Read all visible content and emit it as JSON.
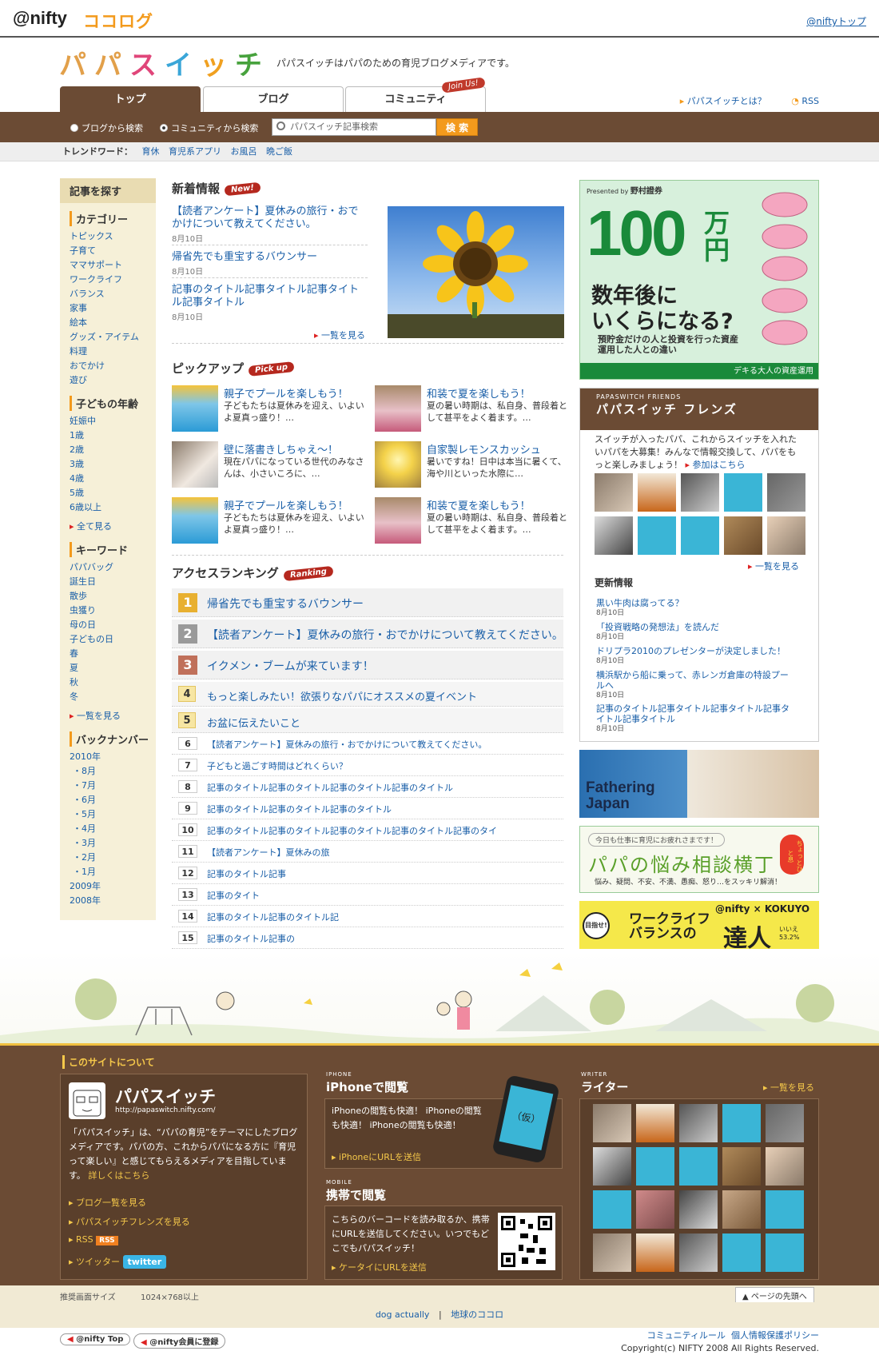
{
  "global": {
    "nifty": "@nifty",
    "cocolog": "ココログ",
    "top_link": "@niftyトップ"
  },
  "header": {
    "logo": [
      "パ",
      "パ",
      "ス",
      "イ",
      "ッ",
      "チ"
    ],
    "tagline": "パパスイッチはパパのための育児ブログメディアです。",
    "tabs": [
      "トップ",
      "ブログ",
      "コミュニティ"
    ],
    "join_badge": "Join Us!",
    "links": [
      "パパスイッチとは？",
      "RSS"
    ]
  },
  "search": {
    "radio_blog": "ブログから検索",
    "radio_community": "コミュニティから検索",
    "placeholder": "パパスイッチ記事検索",
    "button": "検 索"
  },
  "trend": {
    "label": "トレンドワード：",
    "words": [
      "育休",
      "育児系アプリ",
      "お風呂",
      "晩ご飯"
    ]
  },
  "leftnav": {
    "head": "記事を探す",
    "category": {
      "title": "カテゴリー",
      "items": [
        "トピックス",
        "子育て",
        "ママサポート",
        "ワークライフ",
        "バランス",
        "家事",
        "絵本",
        "グッズ・アイテム",
        "料理",
        "おでかけ",
        "遊び"
      ]
    },
    "age": {
      "title": "子どもの年齢",
      "items": [
        "妊娠中",
        "1歳",
        "2歳",
        "3歳",
        "4歳",
        "5歳",
        "6歳以上"
      ],
      "more": "全て見る"
    },
    "keyword": {
      "title": "キーワード",
      "items": [
        "パパバッグ",
        "誕生日",
        "散歩",
        "虫獲り",
        "母の日",
        "子どもの日",
        "春",
        "夏",
        "秋",
        "冬"
      ],
      "more": "一覧を見る"
    },
    "backnumber": {
      "title": "バックナンバー",
      "y2010": "2010年",
      "months": [
        "・8月",
        "・7月",
        "・6月",
        "・5月",
        "・4月",
        "・3月",
        "・2月",
        "・1月"
      ],
      "y2009": "2009年",
      "y2008": "2008年"
    }
  },
  "news": {
    "title": "新着情報",
    "badge": "New!",
    "items": [
      {
        "title": "【読者アンケート】夏休みの旅行・おでかけについて教えてください。",
        "date": "8月10日"
      },
      {
        "title": "帰省先でも重宝するバウンサー",
        "date": "8月10日"
      },
      {
        "title": "記事のタイトル記事タイトル記事タイトル記事タイトル",
        "date": "8月10日"
      }
    ],
    "more": "一覧を見る"
  },
  "pickup": {
    "title": "ピックアップ",
    "badge": "Pick up",
    "items": [
      {
        "title": "親子でプールを楽しもう！",
        "summary": "子どもたちは夏休みを迎え、いよいよ夏真っ盛り！…"
      },
      {
        "title": "和装で夏を楽しもう！",
        "summary": "夏の暑い時期は、私自身、普段着として甚平をよく着ます。…"
      },
      {
        "title": "壁に落書きしちゃえ〜！",
        "summary": "現在パパになっている世代のみなさんは、小さいころに、…"
      },
      {
        "title": "自家製レモンスカッシュ",
        "summary": "暑いですね！日中は本当に暑くて、海や川といった水際に…"
      },
      {
        "title": "親子でプールを楽しもう！",
        "summary": "子どもたちは夏休みを迎え、いよいよ夏真っ盛り！…"
      },
      {
        "title": "和装で夏を楽しもう！",
        "summary": "夏の暑い時期は、私自身、普段着として甚平をよく着ます。…"
      }
    ]
  },
  "ranking": {
    "title": "アクセスランキング",
    "badge": "Ranking",
    "items": [
      {
        "n": "1",
        "title": "帰省先でも重宝するバウンサー"
      },
      {
        "n": "2",
        "title": "【読者アンケート】夏休みの旅行・おでかけについて教えてください。"
      },
      {
        "n": "3",
        "title": "イクメン・ブームが来ています！"
      },
      {
        "n": "4",
        "title": "もっと楽しみたい！欲張りなパパにオススメの夏イベント"
      },
      {
        "n": "5",
        "title": "お盆に伝えたいこと"
      },
      {
        "n": "6",
        "title": "【読者アンケート】夏休みの旅行・おでかけについて教えてください。"
      },
      {
        "n": "7",
        "title": "子どもと過ごす時間はどれくらい？"
      },
      {
        "n": "8",
        "title": "記事のタイトル記事のタイトル記事のタイトル記事のタイトル"
      },
      {
        "n": "9",
        "title": "記事のタイトル記事のタイトル記事のタイトル"
      },
      {
        "n": "10",
        "title": "記事のタイトル記事のタイトル記事のタイトル記事のタイトル記事のタイ"
      },
      {
        "n": "11",
        "title": "【読者アンケート】夏休みの旅"
      },
      {
        "n": "12",
        "title": "記事のタイトル記事"
      },
      {
        "n": "13",
        "title": "記事のタイト"
      },
      {
        "n": "14",
        "title": "記事のタイトル記事のタイトル記"
      },
      {
        "n": "15",
        "title": "記事のタイトル記事の"
      }
    ]
  },
  "ad100": {
    "presented": "Presented by",
    "sponsor": "野村證券",
    "big": "100",
    "unit": "万円",
    "line1": "数年後に",
    "line2": "いくらになる?",
    "sub": "預貯金だけの人と投資を行った資産運用した人との違い",
    "foot": "デキる大人の資産運用"
  },
  "friends": {
    "eyebrow": "PAPASWITCH FRIENDS",
    "title": "パパスイッチ フレンズ",
    "desc": "スイッチが入ったパパ、これからスイッチを入れたいパパを大募集！みんなで情報交換して、パパをもっと楽しみましょう！",
    "join": "参加はこちら",
    "more": "一覧を見る",
    "update_title": "更新情報",
    "updates": [
      {
        "title": "黒い牛肉は腐ってる？",
        "date": "8月10日"
      },
      {
        "title": "「投資戦略の発想法」を読んだ",
        "date": "8月10日"
      },
      {
        "title": "ドリプラ2010のプレゼンターが決定しました！",
        "date": "8月10日"
      },
      {
        "title": "横浜駅から船に乗って、赤レンガ倉庫の特設プールへ",
        "date": "8月10日"
      },
      {
        "title": "記事のタイトル記事タイトル記事タイトル記事タイトル記事タイトル",
        "date": "8月10日"
      }
    ]
  },
  "banners": {
    "fathering": [
      "Fathering",
      "Japan"
    ],
    "nayami_top": "今日も仕事に育児にお疲れさまです！",
    "nayami": "パパの悩み相談横丁",
    "nayami_sub": "悩み、疑問、不安、不満、愚痴、怒り…をスッキリ解消！",
    "lantern": "ちょっとひと息",
    "wlb_prefix": "目指せ!",
    "wlb": [
      "ワークライフ",
      "バランスの"
    ],
    "wlb_big": "達人",
    "wlb_brand": "@nifty × KOKUYO",
    "wlb_stat": "いいえ 53.2%"
  },
  "footer": {
    "about_title": "このサイトについて",
    "site_name": "パパスイッチ",
    "site_url": "http://papaswitch.nifty.com/",
    "about_text": "「パパスイッチ」は、“パパの育児”をテーマにしたブログメディアです。パパの方、これからパパになる方に『育児って楽しい』と感じてもらえるメディアを目指しています。",
    "detail": "詳しくはこちら",
    "links": [
      "ブログ一覧を見る",
      "パパスイッチフレンズを見る",
      "RSS",
      "ツイッター"
    ],
    "rss_badge": "RSS",
    "twitter_badge": "twitter",
    "iphone_eyebrow": "IPHONE",
    "iphone_title": "iPhoneで閲覧",
    "iphone_text": "iPhoneの閲覧も快適！ iPhoneの閲覧も快適！ iPhoneの閲覧も快適！",
    "iphone_link": "iPhoneにURLを送信",
    "iphone_kari": "（仮）",
    "mobile_eyebrow": "MOBILE",
    "mobile_title": "携帯で閲覧",
    "mobile_text": "こちらのバーコードを読み取るか、携帯にURLを送信してください。いつでもどこでもパパスイッチ！",
    "mobile_link": "ケータイにURLを送信",
    "writer_eyebrow": "WRITER",
    "writer_title": "ライター",
    "writer_more": "一覧を見る",
    "screen_label": "推奨画面サイズ",
    "screen_value": "1024×768以上",
    "pagetop": "ページの先頭へ"
  },
  "bottom": {
    "links": [
      "dog actually",
      "地球のココロ"
    ],
    "sep": "|",
    "nifty_top": "@nifty Top",
    "nifty_join": "@nifty会員に登録",
    "rules": [
      "コミュニティルール",
      "個人情報保護ポリシー"
    ],
    "copyright": "Copyright(c) NIFTY 2008 All Rights Reserved."
  }
}
